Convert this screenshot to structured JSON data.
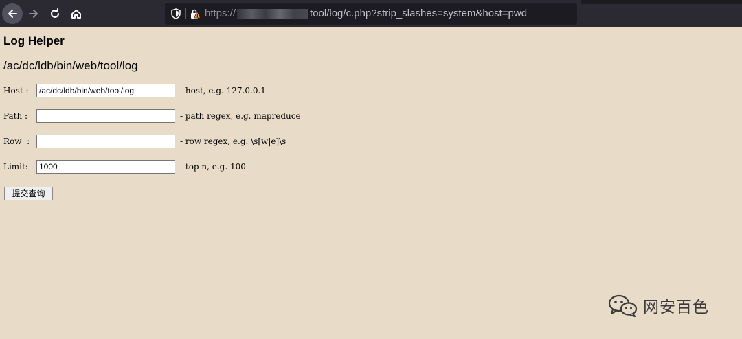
{
  "browser": {
    "url_prefix": "https://",
    "url_path": "tool/log/c.php?strip_slashes=system&host=pwd"
  },
  "page": {
    "title": "Log Helper",
    "path_heading": "/ac/dc/ldb/bin/web/tool/log"
  },
  "form": {
    "host": {
      "label": "Host :",
      "value": "/ac/dc/ldb/bin/web/tool/log",
      "hint": "- host, e.g. 127.0.0.1"
    },
    "path": {
      "label": "Path :",
      "value": "",
      "hint": "- path regex, e.g. mapreduce"
    },
    "row": {
      "label": "Row  :",
      "value": "",
      "hint": "- row regex, e.g. \\s[w|e]\\s"
    },
    "limit": {
      "label": "Limit:",
      "value": "1000",
      "hint": "- top n, e.g. 100"
    },
    "submit_label": "提交查询"
  },
  "watermark": {
    "text": "网安百色"
  }
}
